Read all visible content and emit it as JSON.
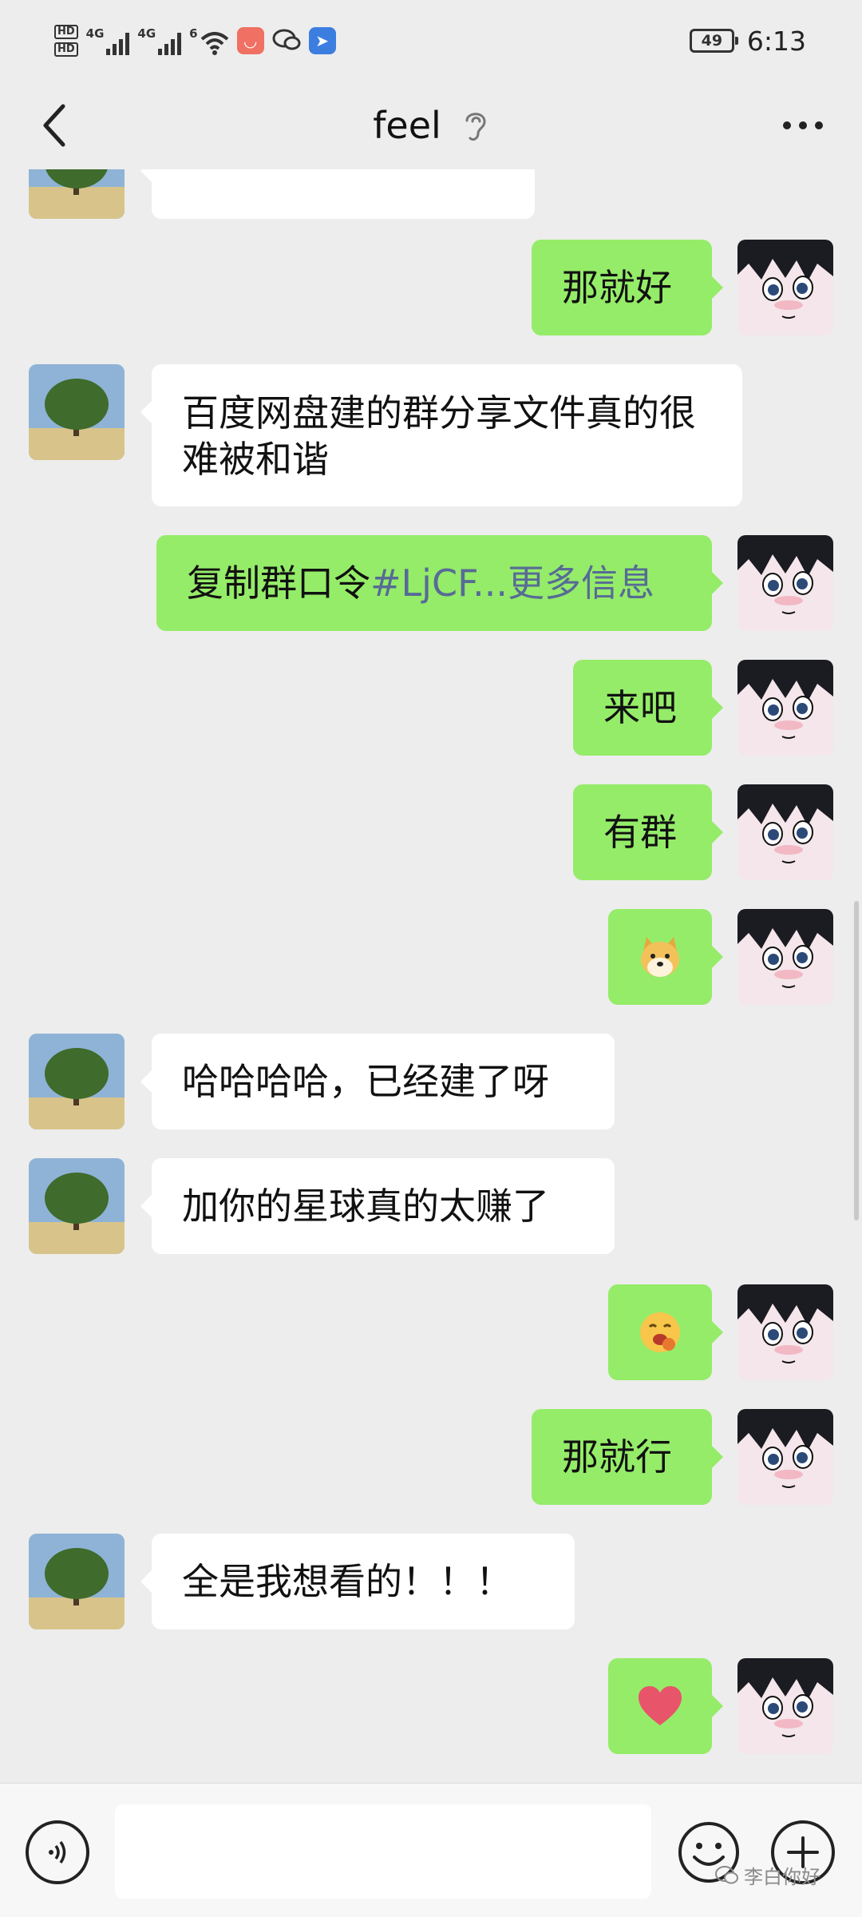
{
  "status_bar": {
    "hd_label_1": "HD",
    "hd_label_2": "HD",
    "net_label_1": "4G",
    "net_label_2": "4G",
    "wifi_label": "6",
    "battery": "49",
    "time": "6:13"
  },
  "header": {
    "title": "feel",
    "back_icon": "chevron-left-icon",
    "ear_icon": "ear-icon",
    "more_icon": "more-dots-icon"
  },
  "messages": [
    {
      "side": "left",
      "text": "",
      "partial": true
    },
    {
      "side": "right",
      "text": "那就好"
    },
    {
      "side": "left",
      "text": "百度网盘建的群分享文件真的很难被和谐"
    },
    {
      "side": "right",
      "text_prefix": "复制群口令",
      "link_text": "#LjCF...更多信息"
    },
    {
      "side": "right",
      "text": "来吧"
    },
    {
      "side": "right",
      "text": "有群"
    },
    {
      "side": "right",
      "emoji": "doge-emoji"
    },
    {
      "side": "left",
      "text": "哈哈哈哈，已经建了呀"
    },
    {
      "side": "left",
      "text": "加你的星球真的太赚了"
    },
    {
      "side": "right",
      "emoji": "hungry-face-emoji"
    },
    {
      "side": "right",
      "text": "那就行"
    },
    {
      "side": "left",
      "text": "全是我想看的！！！"
    },
    {
      "side": "right",
      "emoji": "heart-emoji"
    }
  ],
  "input_bar": {
    "voice_icon": "voice-icon",
    "emoji_icon": "smile-icon",
    "plus_icon": "plus-icon",
    "text_value": ""
  },
  "watermark": {
    "text": "李白你好"
  },
  "colors": {
    "background": "#ededed",
    "bubble_self": "#95ec69",
    "bubble_other": "#ffffff",
    "link": "#576b95"
  }
}
